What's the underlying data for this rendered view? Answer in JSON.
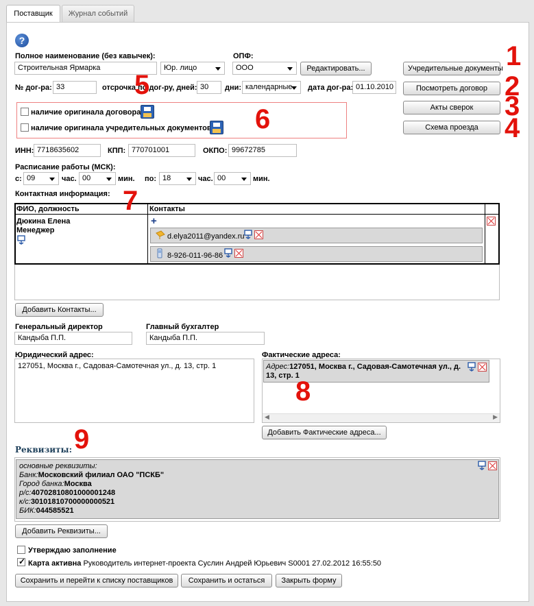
{
  "tabs": [
    {
      "label": "Поставщик"
    },
    {
      "label": "Журнал событий"
    }
  ],
  "form": {
    "full_name_label": "Полное наименование (без кавычек):",
    "full_name_value": "Строительная Ярмарка",
    "entity_type": "Юр. лицо",
    "opf_label": "ОПФ:",
    "opf_value": "ООО",
    "edit_button": "Редактировать...",
    "contract_no_label": "№ дог-ра:",
    "contract_no_value": "33",
    "deferral_label": "отсрочка по дог-ру, дней:",
    "deferral_value": "30",
    "days_label": "дни:",
    "days_value": "календарные",
    "contract_date_label": "дата дог-ра:",
    "contract_date_value": "01.10.2010",
    "original_contract_label": "наличие оригинала договора",
    "original_docs_label": "наличие оригинала учредительных документов",
    "inn_label": "ИНН:",
    "inn_value": "7718635602",
    "kpp_label": "КПП:",
    "kpp_value": "770701001",
    "okpo_label": "ОКПО:",
    "okpo_value": "99672785",
    "schedule_label": "Расписание работы (МСК):",
    "from_label": "с:",
    "from_hour": "09",
    "hour_label": "час.",
    "from_min": "00",
    "min_label": "мин.",
    "to_label": "по:",
    "to_hour": "18",
    "to_min": "00",
    "contact_info_label": "Контактная информация:",
    "contacts_table": {
      "col_name": "ФИО, должность",
      "col_contacts": "Контакты",
      "person_name": "Дюкина Елена",
      "person_role": "Менеджер",
      "add_symbol": "+",
      "email": "d.elya2011@yandex.ru",
      "phone": "8-926-011-96-86"
    },
    "add_contacts_button": "Добавить Контакты...",
    "director_label": "Генеральный директор",
    "director_value": "Кандыба П.П.",
    "accountant_label": "Главный бухгалтер",
    "accountant_value": "Кандыба П.П.",
    "legal_address_label": "Юридический адрес:",
    "legal_address_value": "127051, Москва г., Садовая-Самотечная ул., д. 13, стр. 1",
    "actual_addresses_label": "Фактические адреса:",
    "actual_address_prefix": "Адрес:",
    "actual_address_value": "127051, Москва г., Садовая-Самотечная ул., д. 13, стр. 1",
    "add_actual_address_button": "Добавить Фактические адреса...",
    "requisites_label": "Реквизиты:",
    "requisites": {
      "header": "основные реквизиты:",
      "bank_label": "Банк:",
      "bank_value": "Московский филиал ОАО \"ПСКБ\"",
      "city_label": "Город банка:",
      "city_value": "Москва",
      "rs_label": "р/с:",
      "rs_value": "40702810801000001248",
      "ks_label": "к/с:",
      "ks_value": "30101810700000000521",
      "bik_label": "БИК:",
      "bik_value": "044585521"
    },
    "add_requisites_button": "Добавить Реквизиты...",
    "confirm_label": "Утверждаю заполнение",
    "card_active_label": "Карта активна",
    "card_active_info": "Руководитель интернет-проекта Суслин Андрей Юрьевич S0001 27.02.2012 16:55:50",
    "save_to_list_button": "Сохранить и перейти к списку поставщиков",
    "save_stay_button": "Сохранить и остаться",
    "close_button": "Закрыть форму"
  },
  "side_buttons": [
    {
      "label": "Учредительные документы"
    },
    {
      "label": "Посмотреть договор"
    },
    {
      "label": "Акты сверок"
    },
    {
      "label": "Схема проезда"
    }
  ],
  "annotations": {
    "n1": "1",
    "n2": "2",
    "n3": "3",
    "n4": "4",
    "n5": "5",
    "n6": "6",
    "n7": "7",
    "n8": "8",
    "n9": "9"
  },
  "colors": {
    "annotation": "#e3120b",
    "panel": "#ffffff",
    "background": "#e7e7e7"
  }
}
